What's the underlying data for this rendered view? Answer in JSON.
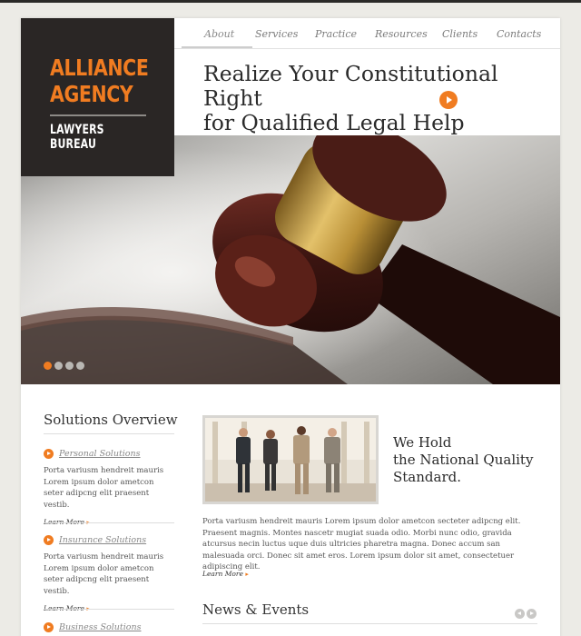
{
  "logo": {
    "line1": "ALLIANCE",
    "line2": "AGENCY",
    "subtitle": "LAWYERS BUREAU"
  },
  "nav": {
    "items": [
      {
        "label": "About",
        "active": true
      },
      {
        "label": "Services",
        "active": false
      },
      {
        "label": "Practice",
        "active": false
      },
      {
        "label": "Resources",
        "active": false
      },
      {
        "label": "Clients",
        "active": false
      },
      {
        "label": "Contacts",
        "active": false
      }
    ]
  },
  "headline": {
    "line1": "Realize Your Constitutional Right",
    "line2": "for Qualified Legal Help"
  },
  "slider": {
    "slide_count": 4,
    "active_index": 0
  },
  "sidebar": {
    "title": "Solutions Overview",
    "items": [
      {
        "title": "Personal Solutions",
        "text": "Porta variusm hendreit mauris Lorem ipsum dolor ametcon seter adipcng elit praesent vestib.",
        "learn_more": "Learn More"
      },
      {
        "title": "Insurance Solutions",
        "text": "Porta variusm hendreit mauris Lorem ipsum dolor ametcon seter adipcng elit praesent vestib.",
        "learn_more": "Learn More"
      },
      {
        "title": "Business Solutions",
        "text": "",
        "learn_more": ""
      }
    ]
  },
  "main": {
    "quality_line1": "We Hold",
    "quality_line2": "the National Quality",
    "quality_line3": "Standard.",
    "paragraph": "Porta variusm hendreit mauris Lorem ipsum dolor ametcon secteter adipcng elit. Praesent magnis. Montes nascetr mugiat suada odio. Morbi nunc odio, gravida atcursus necin luctus uque duis ultricies pharetra magna. Donec accum san malesuada orci. Donec sit amet eros. Lorem ipsum dolor sit amet, consectetuer adipiscing elit.",
    "learn_more": "Learn More"
  },
  "news": {
    "title": "News & Events"
  },
  "colors": {
    "accent": "#f07c21",
    "logo_bg": "#2a2625",
    "page_bg": "#ecebe6"
  }
}
